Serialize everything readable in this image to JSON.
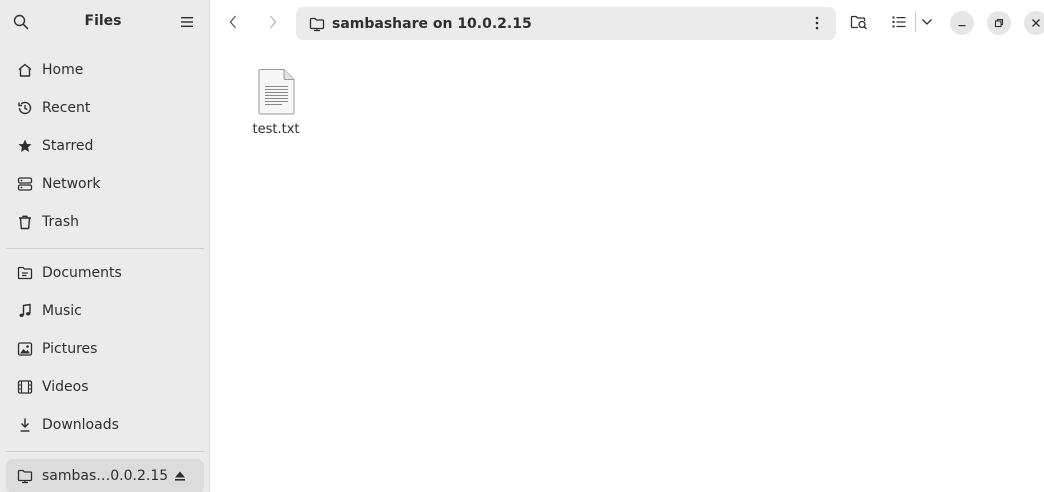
{
  "sidebar": {
    "title": "Files",
    "places": [
      {
        "label": "Home",
        "icon": "home-icon"
      },
      {
        "label": "Recent",
        "icon": "recent-icon"
      },
      {
        "label": "Starred",
        "icon": "star-icon"
      },
      {
        "label": "Network",
        "icon": "network-icon"
      },
      {
        "label": "Trash",
        "icon": "trash-icon"
      }
    ],
    "bookmarks": [
      {
        "label": "Documents",
        "icon": "documents-icon"
      },
      {
        "label": "Music",
        "icon": "music-icon"
      },
      {
        "label": "Pictures",
        "icon": "pictures-icon"
      },
      {
        "label": "Videos",
        "icon": "videos-icon"
      },
      {
        "label": "Downloads",
        "icon": "downloads-icon"
      }
    ],
    "mount": {
      "label": "sambas…0.0.2.15",
      "icon": "network-folder-icon"
    }
  },
  "header": {
    "location": "sambashare on 10.0.2.15"
  },
  "files": [
    {
      "name": "test.txt",
      "icon": "text-file-icon"
    }
  ],
  "colors": {
    "sidebar_bg": "#ebebeb",
    "pathbar_bg": "#ebebeb",
    "text": "#2e2e2e"
  }
}
